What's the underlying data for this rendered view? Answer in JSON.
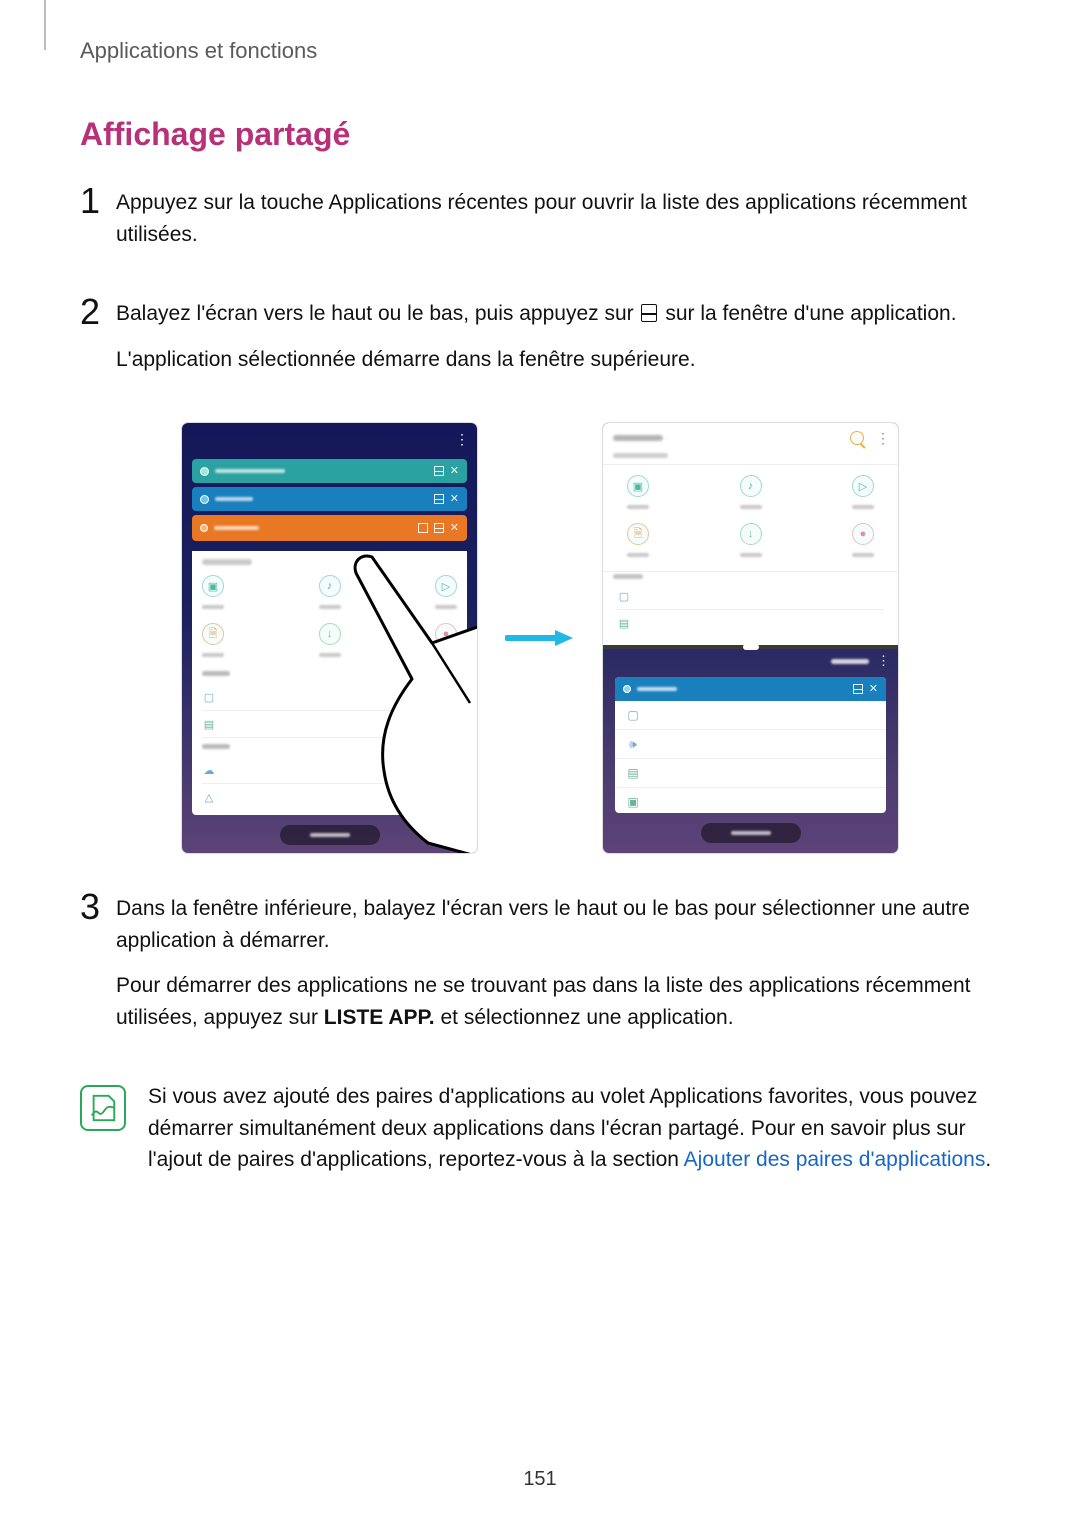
{
  "breadcrumb": "Applications et fonctions",
  "section_title": "Affichage partagé",
  "steps": {
    "s1": {
      "number": "1",
      "text": "Appuyez sur la touche Applications récentes pour ouvrir la liste des applications récemment utilisées."
    },
    "s2": {
      "number": "2",
      "line1_a": "Balayez l'écran vers le haut ou le bas, puis appuyez sur ",
      "line1_b": " sur la fenêtre d'une application.",
      "line2": "L'application sélectionnée démarre dans la fenêtre supérieure."
    },
    "s3": {
      "number": "3",
      "p1": "Dans la fenêtre inférieure, balayez l'écran vers le haut ou le bas pour sélectionner une autre application à démarrer.",
      "p2_a": "Pour démarrer des applications ne se trouvant pas dans la liste des applications récemment utilisées, appuyez sur ",
      "p2_bold": "LISTE APP.",
      "p2_b": " et sélectionnez une application."
    }
  },
  "note": {
    "text_a": "Si vous avez ajouté des paires d'applications au volet Applications favorites, vous pouvez démarrer simultanément deux applications dans l'écran partagé. Pour en savoir plus sur l'ajout de paires d'applications, reportez-vous à la section ",
    "link": "Ajouter des paires d'applications",
    "text_b": "."
  },
  "page_number": "151"
}
